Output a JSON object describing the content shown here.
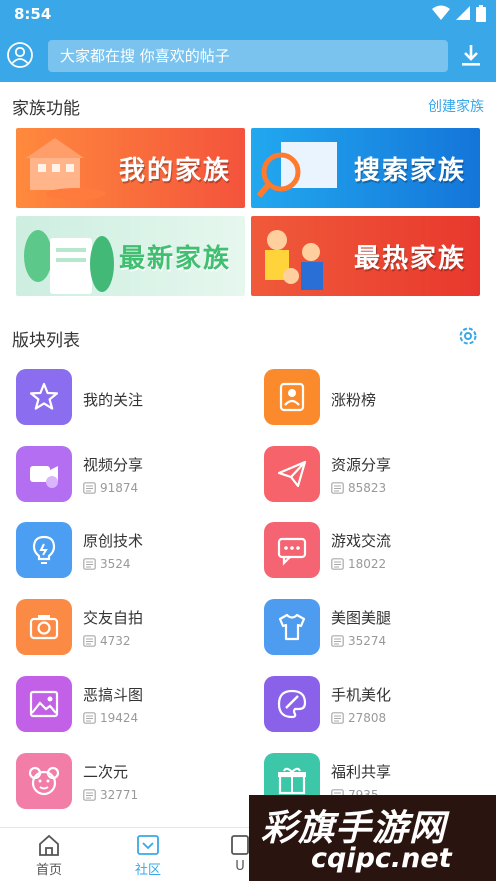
{
  "status": {
    "time": "8:54"
  },
  "search": {
    "placeholder": "大家都在搜 你喜欢的帖子"
  },
  "family": {
    "title": "家族功能",
    "create_link": "创建家族",
    "banners": [
      "我的家族",
      "搜索家族",
      "最新家族",
      "最热家族"
    ]
  },
  "boards": {
    "title": "版块列表",
    "items": [
      {
        "name": "我的关注",
        "icon": "star-icon",
        "color": "#8b6df0"
      },
      {
        "name": "涨粉榜",
        "icon": "ranking-badge-icon",
        "color": "#fb8a2c"
      },
      {
        "name": "视频分享",
        "count": "91874",
        "icon": "video-share-icon",
        "color": "#b36ef2"
      },
      {
        "name": "资源分享",
        "count": "85823",
        "icon": "paper-plane-icon",
        "color": "#f6636b"
      },
      {
        "name": "原创技术",
        "count": "3524",
        "icon": "lightbulb-icon",
        "color": "#4b9ef2"
      },
      {
        "name": "游戏交流",
        "count": "18022",
        "icon": "chat-bubble-icon",
        "color": "#f56473"
      },
      {
        "name": "交友自拍",
        "count": "4732",
        "icon": "camera-icon",
        "color": "#fb8a45"
      },
      {
        "name": "美图美腿",
        "count": "35274",
        "icon": "tshirt-icon",
        "color": "#4e9cf0"
      },
      {
        "name": "恶搞斗图",
        "count": "19424",
        "icon": "picture-icon",
        "color": "#c260e8"
      },
      {
        "name": "手机美化",
        "count": "27808",
        "icon": "palette-icon",
        "color": "#8a62ea"
      },
      {
        "name": "二次元",
        "count": "32771",
        "icon": "bear-face-icon",
        "color": "#f27da6"
      },
      {
        "name": "福利共享",
        "count": "7935",
        "icon": "gift-icon",
        "color": "#3cc7a8"
      }
    ]
  },
  "tabs": [
    "首页",
    "社区",
    "U"
  ],
  "watermark": {
    "line1": "彩旗手游网",
    "line2": "cqipc.net"
  }
}
